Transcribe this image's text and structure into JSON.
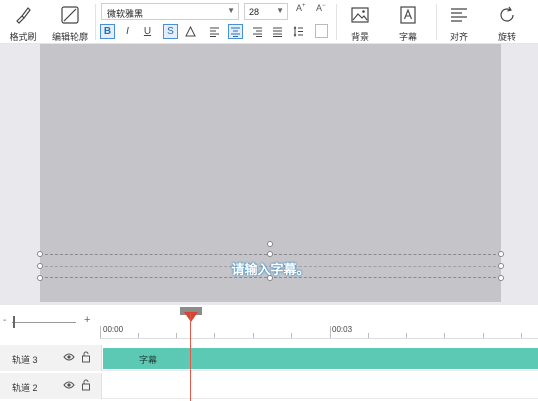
{
  "toolbar": {
    "format_brush": "格式刷",
    "edit_outline": "编辑轮廓",
    "font_name": "微软雅黑",
    "font_size": "28",
    "font_grow": "A",
    "font_shrink": "A",
    "bold": "B",
    "italic": "I",
    "underline": "U",
    "strikethrough": "S",
    "background": "背景",
    "subtitle": "字幕",
    "align": "对齐",
    "rotate": "旋转"
  },
  "canvas": {
    "subtitle_text": "请输入字幕。"
  },
  "timeline": {
    "zoom_minus": "-",
    "zoom_plus": "+",
    "time_labels": [
      "00:00",
      "00:03"
    ],
    "tracks": [
      {
        "name": "轨道 3",
        "clip": "字幕"
      },
      {
        "name": "轨道 2",
        "clip": ""
      }
    ]
  },
  "colors": {
    "accent": "#4a90d9",
    "clip": "#5cc9b5",
    "playhead": "#e15a4a",
    "video_bg": "#c5c5c9"
  }
}
